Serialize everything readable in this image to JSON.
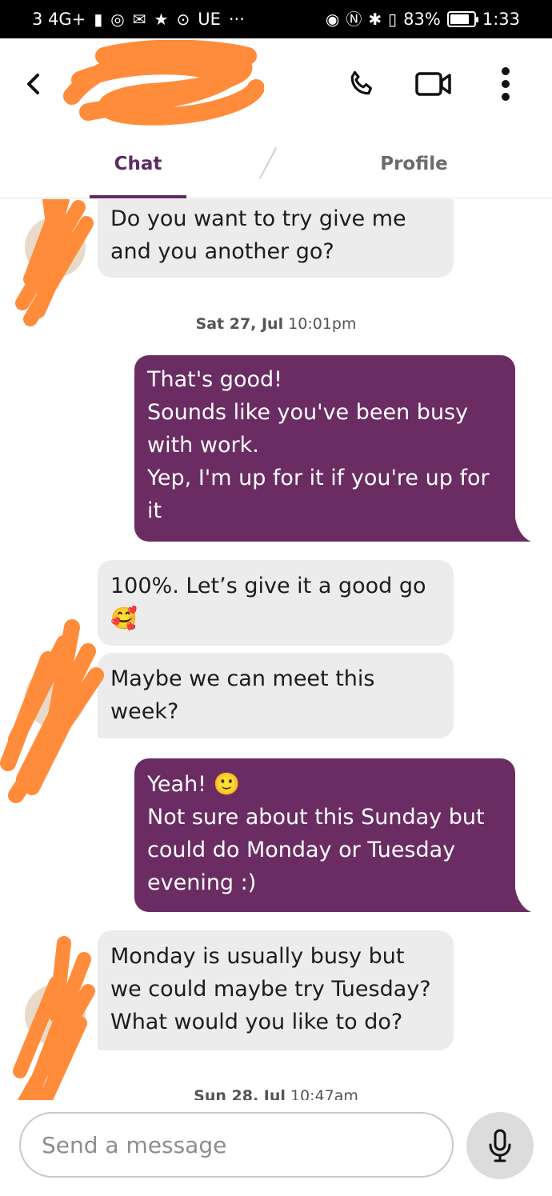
{
  "status_bar": {
    "network": "3 4G+",
    "network_label": "UE",
    "more": "···",
    "battery_percent": "83%",
    "battery_level": 0.83,
    "time": "1:33"
  },
  "header": {
    "back_icon": "chevron-left-icon",
    "call_icon": "phone-icon",
    "video_icon": "video-camera-icon",
    "menu_icon": "more-vertical-icon"
  },
  "tabs": [
    {
      "label": "Chat",
      "active": true
    },
    {
      "label": "Profile",
      "active": false
    }
  ],
  "messages": [
    {
      "direction": "incoming",
      "lines": [
        "Do you want to try give me",
        "and you another go?"
      ]
    },
    {
      "timestamp_date": "Sat 27, Jul",
      "timestamp_time": "10:01pm"
    },
    {
      "direction": "outgoing",
      "lines": [
        "That's good!",
        "Sounds like you've been busy",
        "with work.",
        "Yep, I'm up for it if you're up for",
        "it"
      ]
    },
    {
      "direction": "incoming",
      "lines": [
        "100%. Let’s give it a good go",
        "🥰"
      ]
    },
    {
      "direction": "incoming",
      "lines": [
        "Maybe we can meet this",
        "week?"
      ]
    },
    {
      "direction": "outgoing",
      "lines": [
        "Yeah! 🙂",
        "Not sure about this Sunday but",
        "could do Monday or Tuesday",
        "evening :)"
      ]
    },
    {
      "direction": "incoming",
      "lines": [
        "Monday is usually busy but",
        "we could maybe try Tuesday?",
        "What would you like to do?"
      ]
    },
    {
      "timestamp_date": "Sun 28, Jul",
      "timestamp_time": "10:47am"
    }
  ],
  "composer": {
    "placeholder": "Send a message",
    "mic_icon": "microphone-icon"
  },
  "colors": {
    "accent": "#5e2a62",
    "outgoing_bubble": "#6a2c63",
    "incoming_bubble": "#ececec",
    "redaction": "#ff8c3a"
  }
}
